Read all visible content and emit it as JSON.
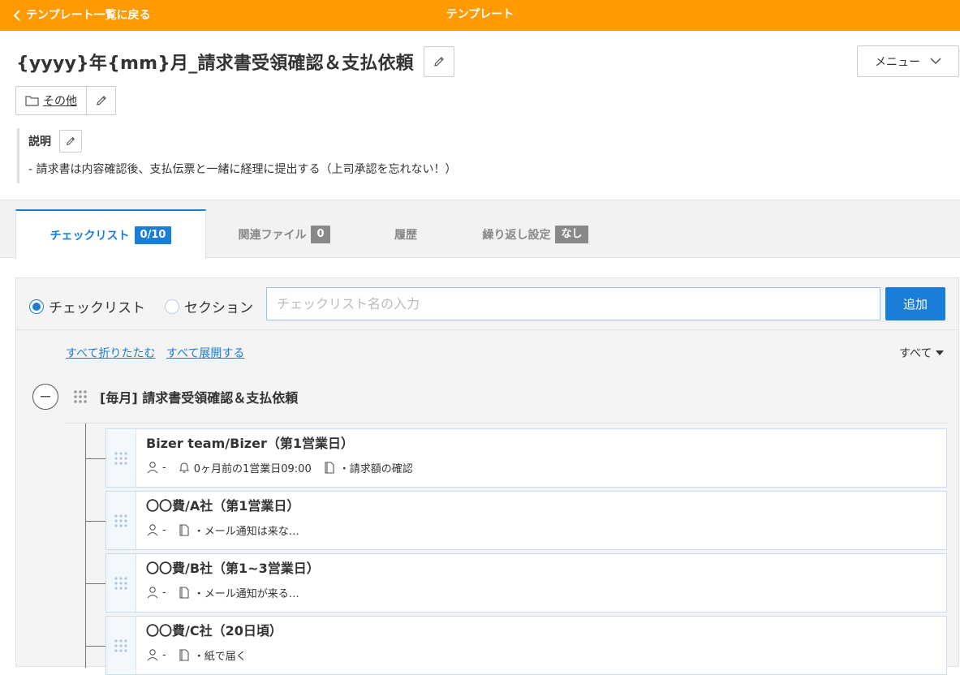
{
  "header": {
    "back_label": "テンプレート一覧に戻る",
    "title": "テンプレート"
  },
  "template": {
    "title": "{yyyy}年{mm}月_請求書受領確認＆支払依頼",
    "menu_label": "メニュー",
    "category": "その他",
    "description_label": "説明",
    "description": "- 請求書は内容確認後、支払伝票と一緒に経理に提出する（上司承認を忘れない！）"
  },
  "tabs": [
    {
      "label": "チェックリスト",
      "badge": "0/10",
      "active": true
    },
    {
      "label": "関連ファイル",
      "badge": "0",
      "active": false
    },
    {
      "label": "履歴",
      "badge": "",
      "active": false
    },
    {
      "label": "繰り返し設定",
      "badge": "なし",
      "active": false
    }
  ],
  "add_form": {
    "radio_checklist": "チェックリスト",
    "radio_section": "セクション",
    "selected": "checklist",
    "input_placeholder": "チェックリスト名の入力",
    "add_button": "追加"
  },
  "controls": {
    "collapse_all": "すべて折りたたむ",
    "expand_all": "すべて展開する",
    "filter": "すべて"
  },
  "section": {
    "title": "[毎月] 請求書受領確認＆支払依頼"
  },
  "items": [
    {
      "title": "Bizer team/Bizer（第1営業日）",
      "assignee": "-",
      "reminder": "0ヶ月前の1営業日09:00",
      "note": "・請求額の確認"
    },
    {
      "title": "〇〇費/A社（第1営業日）",
      "assignee": "-",
      "reminder": "",
      "note": "・メール通知は来な…"
    },
    {
      "title": "〇〇費/B社（第1~3営業日）",
      "assignee": "-",
      "reminder": "",
      "note": "・メール通知が来る…"
    },
    {
      "title": "〇〇費/C社（20日頃）",
      "assignee": "-",
      "reminder": "",
      "note": "・紙で届く"
    }
  ],
  "colors": {
    "header_bg": "#ff9a00",
    "accent": "#1a7ed9"
  }
}
